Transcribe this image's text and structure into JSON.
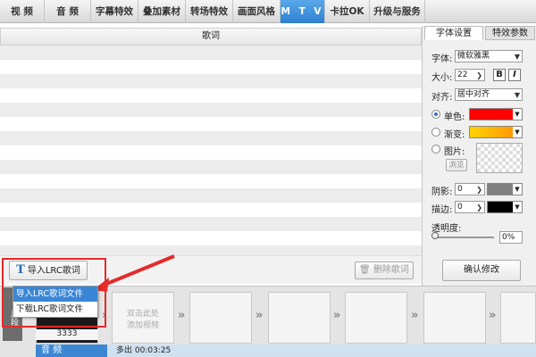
{
  "top_tabs": [
    "视  频",
    "音  频",
    "字幕特效",
    "叠加素材",
    "转场特效",
    "画面风格",
    "M T V",
    "卡拉OK",
    "升级与服务"
  ],
  "lyrics": {
    "header": "歌词",
    "import_btn": "导入LRC歌词",
    "delete_btn": "删除歌词"
  },
  "popup": {
    "items": [
      "导入LRC歌词文件",
      "下载LRC歌词文件"
    ]
  },
  "right_panel": {
    "tab_font": "字体设置",
    "tab_effect": "特效参数",
    "font_label": "字体:",
    "font_value": "微软雅黑",
    "size_label": "大小:",
    "size_value": "22",
    "bold": "B",
    "italic": "I",
    "align_label": "对齐:",
    "align_value": "居中对齐",
    "single_label": "单色:",
    "single_color": "#ff0000",
    "gradient_label": "渐变:",
    "image_label": "图片:",
    "browse": "浏览",
    "shadow_label": "阴影:",
    "shadow_value": "0",
    "shadow_color": "#808080",
    "stroke_label": "描边:",
    "stroke_value": "0",
    "stroke_color": "#000000",
    "opacity_label": "透明度:",
    "opacity_value": "0%",
    "confirm": "确认修改"
  },
  "timeline": {
    "clip_label": "3333",
    "add_hint_1": "双击此处",
    "add_hint_2": "添加视频",
    "side_label": "片段",
    "audio_label": "音  频",
    "audio_time": "多出 00:03:25"
  }
}
